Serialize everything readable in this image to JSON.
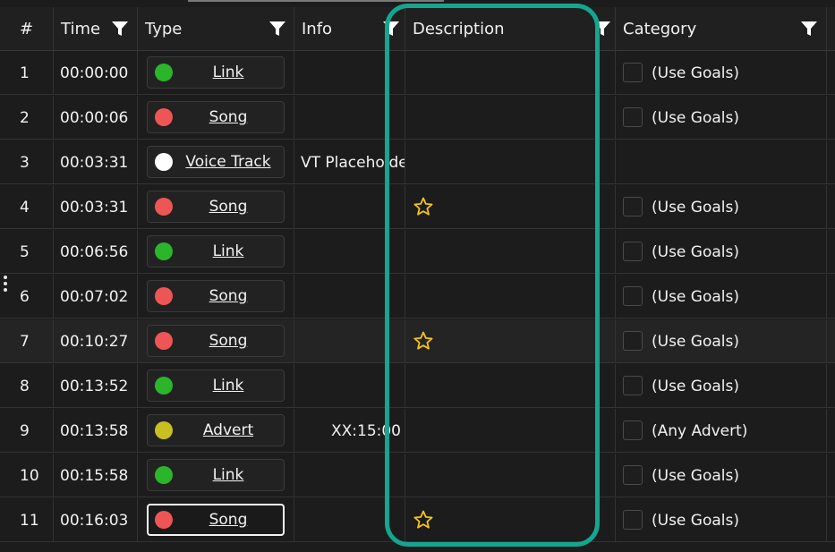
{
  "headers": {
    "num": "#",
    "time": "Time",
    "type": "Type",
    "info": "Info",
    "description": "Description",
    "category": "Category"
  },
  "colors": {
    "green": "#2bb52b",
    "red": "#ee5555",
    "white": "#ffffff",
    "yellow": "#c8c020",
    "star": "#f5c518",
    "highlight": "#14a68f"
  },
  "rows": [
    {
      "num": "1",
      "time": "00:00:00",
      "type": "Link",
      "dot": "green",
      "info": "",
      "star": false,
      "category": "(Use Goals)",
      "checkbox": true
    },
    {
      "num": "2",
      "time": "00:00:06",
      "type": "Song",
      "dot": "red",
      "info": "",
      "star": false,
      "category": "(Use Goals)",
      "checkbox": true
    },
    {
      "num": "3",
      "time": "00:03:31",
      "type": "Voice Track",
      "dot": "white",
      "info": "VT Placeholde",
      "star": false,
      "category": "",
      "checkbox": false
    },
    {
      "num": "4",
      "time": "00:03:31",
      "type": "Song",
      "dot": "red",
      "info": "",
      "star": true,
      "category": "(Use Goals)",
      "checkbox": true
    },
    {
      "num": "5",
      "time": "00:06:56",
      "type": "Link",
      "dot": "green",
      "info": "",
      "star": false,
      "category": "(Use Goals)",
      "checkbox": true
    },
    {
      "num": "6",
      "time": "00:07:02",
      "type": "Song",
      "dot": "red",
      "info": "",
      "star": false,
      "category": "(Use Goals)",
      "checkbox": true
    },
    {
      "num": "7",
      "time": "00:10:27",
      "type": "Song",
      "dot": "red",
      "info": "",
      "star": true,
      "category": "(Use Goals)",
      "checkbox": true
    },
    {
      "num": "8",
      "time": "00:13:52",
      "type": "Link",
      "dot": "green",
      "info": "",
      "star": false,
      "category": "(Use Goals)",
      "checkbox": true
    },
    {
      "num": "9",
      "time": "00:13:58",
      "type": "Advert",
      "dot": "yellow",
      "info": "XX:15:00",
      "star": false,
      "category": "(Any Advert)",
      "checkbox": true
    },
    {
      "num": "10",
      "time": "00:15:58",
      "type": "Link",
      "dot": "green",
      "info": "",
      "star": false,
      "category": "(Use Goals)",
      "checkbox": true
    },
    {
      "num": "11",
      "time": "00:16:03",
      "type": "Song",
      "dot": "red",
      "info": "",
      "star": true,
      "category": "(Use Goals)",
      "checkbox": true
    }
  ]
}
